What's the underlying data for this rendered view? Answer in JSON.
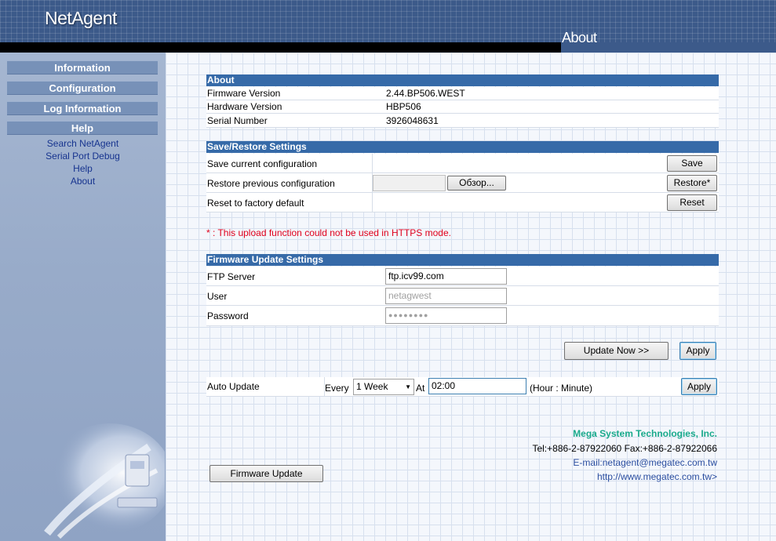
{
  "header": {
    "logo": "NetAgent",
    "page_title": "About"
  },
  "sidebar": {
    "menu": [
      {
        "label": "Information"
      },
      {
        "label": "Configuration"
      },
      {
        "label": "Log Information"
      },
      {
        "label": "Help"
      }
    ],
    "help_links": [
      {
        "label": "Search NetAgent"
      },
      {
        "label": "Serial Port Debug"
      },
      {
        "label": "Help"
      },
      {
        "label": "About"
      }
    ]
  },
  "about": {
    "title": "About",
    "rows": [
      {
        "label": "Firmware Version",
        "value": "2.44.BP506.WEST"
      },
      {
        "label": "Hardware Version",
        "value": "HBP506"
      },
      {
        "label": "Serial Number",
        "value": "3926048631"
      }
    ]
  },
  "save_restore": {
    "title": "Save/Restore Settings",
    "save_label": "Save current configuration",
    "save_button": "Save",
    "restore_label": "Restore previous configuration",
    "browse_button": "Обзор...",
    "restore_button": "Restore*",
    "reset_label": "Reset to factory default",
    "reset_button": "Reset",
    "warning": "* : This upload function could not be used in HTTPS mode."
  },
  "firmware": {
    "title": "Firmware Update Settings",
    "ftp_label": "FTP Server",
    "ftp_value": "ftp.icv99.com",
    "user_label": "User",
    "user_value": "netagwest",
    "password_label": "Password",
    "password_value": "●●●●●●●●",
    "update_now_button": "Update Now >>",
    "apply_button": "Apply"
  },
  "auto_update": {
    "label": "Auto Update",
    "every_label": "Every",
    "interval_value": "1 Week",
    "at_label": "At",
    "time_value": "02:00",
    "time_hint": "(Hour : Minute)",
    "apply_button": "Apply"
  },
  "company": {
    "name": "Mega System Technologies, Inc.",
    "phone": "Tel:+886-2-87922060 Fax:+886-2-87922066",
    "email": "E-mail:netagent@megatec.com.tw",
    "url": "http://www.megatec.com.tw>"
  },
  "firmware_update_button": "Firmware Update",
  "colors": {
    "section_header": "#366aa8",
    "sidebar_button": "#7791b8",
    "link": "#17348f",
    "warning": "#e0001c",
    "company_name": "#1aaa8c",
    "company_link": "#2b4ea0"
  }
}
